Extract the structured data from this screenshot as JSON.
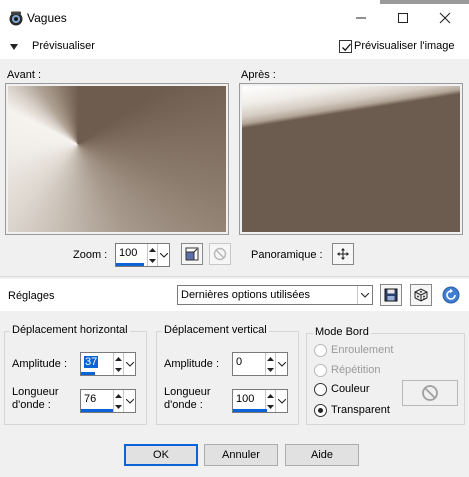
{
  "window": {
    "title": "Vagues",
    "controls": [
      "minimize-icon",
      "maximize-icon",
      "close-icon"
    ]
  },
  "header": {
    "collapse_label": "Prévisualiser",
    "preview_image_label": "Prévisualiser l'image",
    "preview_image_checked": true
  },
  "previews": {
    "before_label": "Avant :",
    "after_label": "Après :"
  },
  "zoom": {
    "label": "Zoom :",
    "value": "100",
    "pan_label": "Panoramique :"
  },
  "reglages": {
    "label": "Réglages",
    "preset_value": "Dernières options utilisées",
    "icons": [
      "save-icon",
      "dice-random-icon",
      "reset-icon"
    ]
  },
  "horizontal": {
    "title": "Déplacement horizontal",
    "amplitude_label": "Amplitude :",
    "amplitude_value": "37",
    "wavelength_label_1": "Longueur",
    "wavelength_label_2": "d'onde :",
    "wavelength_value": "76"
  },
  "vertical": {
    "title": "Déplacement vertical",
    "amplitude_label": "Amplitude :",
    "amplitude_value": "0",
    "wavelength_label_1": "Longueur",
    "wavelength_label_2": "d'onde :",
    "wavelength_value": "100"
  },
  "edge_mode": {
    "title": "Mode Bord",
    "options": [
      {
        "label": "Enroulement",
        "enabled": false,
        "checked": false
      },
      {
        "label": "Répétition",
        "enabled": false,
        "checked": false
      },
      {
        "label": "Couleur",
        "enabled": true,
        "checked": false
      },
      {
        "label": "Transparent",
        "enabled": true,
        "checked": true
      }
    ]
  },
  "buttons": {
    "ok": "OK",
    "cancel": "Annuler",
    "help": "Aide"
  },
  "colors": {
    "accent": "#0a64d8",
    "dialog_bg": "#f0f0f0"
  }
}
